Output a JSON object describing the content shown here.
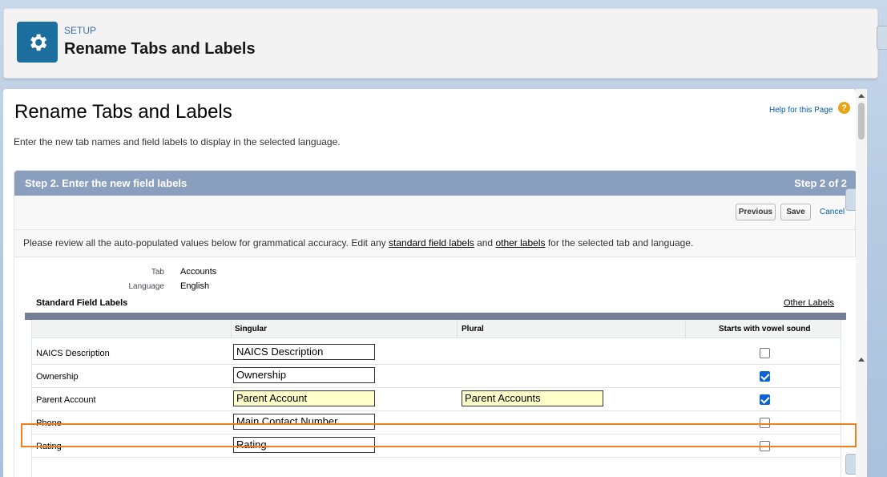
{
  "header": {
    "eyebrow": "SETUP",
    "title": "Rename Tabs and Labels",
    "icon": "gear-icon",
    "icon_bg": "#1c6e9e"
  },
  "page": {
    "title": "Rename Tabs and Labels",
    "help_link": "Help for this Page",
    "description": "Enter the new tab names and field labels to display in the selected language."
  },
  "step": {
    "title": "Step 2. Enter the new field labels",
    "count": "Step 2 of 2",
    "header_color": "#8a9ebe"
  },
  "buttons": {
    "previous": "Previous",
    "save": "Save",
    "cancel": "Cancel"
  },
  "review": {
    "prefix": "Please review all the auto-populated values below for grammatical accuracy. Edit any ",
    "link1": "standard field labels",
    "middle": " and ",
    "link2": "other labels",
    "suffix": " for the selected tab and language."
  },
  "meta": {
    "tab_label": "Tab",
    "tab_value": "Accounts",
    "language_label": "Language",
    "language_value": "English"
  },
  "section": {
    "title": "Standard Field Labels",
    "other_labels_link": "Other Labels"
  },
  "table": {
    "columns": [
      "",
      "Singular",
      "Plural",
      "Starts with vowel sound"
    ],
    "rows": [
      {
        "label": "NAICS Description",
        "singular": "NAICS Description",
        "plural": "",
        "vowel": false
      },
      {
        "label": "Ownership",
        "singular": "Ownership",
        "plural": "",
        "vowel": true
      },
      {
        "label": "Parent Account",
        "singular": "Parent Account",
        "plural": "Parent Accounts",
        "vowel": true
      },
      {
        "label": "Phone",
        "singular": "Main Contact Number",
        "plural": "",
        "vowel": false
      },
      {
        "label": "Rating",
        "singular": "Rating",
        "plural": "",
        "vowel": false
      }
    ]
  },
  "highlight_color": "#f07f1c"
}
